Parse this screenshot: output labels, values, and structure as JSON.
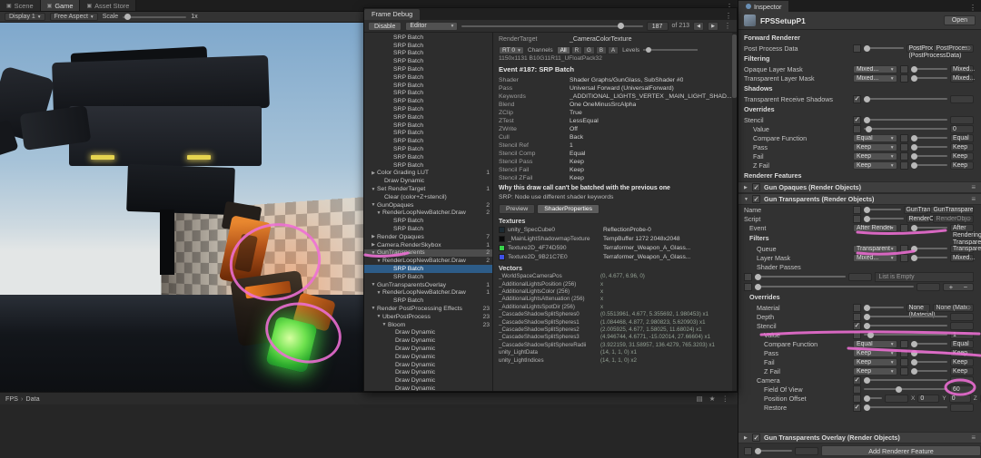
{
  "colors": {
    "annotation": "#ee6fd5",
    "selection": "#2d5c88",
    "glow_green": "#46e03c"
  },
  "icons": {
    "menu": "⋮",
    "star": "★",
    "grid": "▤",
    "prev": "◀",
    "next": "▶",
    "target": "⊙",
    "handle": "≡",
    "cube": "▣"
  },
  "scene_tabs": {
    "tabs": [
      {
        "label": "Scene"
      },
      {
        "label": "Game",
        "active": true
      },
      {
        "label": "Asset Store"
      }
    ]
  },
  "game_toolbar": {
    "display": "Display 1",
    "aspect": "Free Aspect",
    "scale_label": "Scale",
    "scale_value": "1x"
  },
  "project_bar": {
    "root": "FPS",
    "sep": "›",
    "folder": "Data"
  },
  "frame_debug": {
    "title": "Frame Debug",
    "toolbar": {
      "disable": "Disable",
      "target": "Editor",
      "current": "187",
      "total": "of 213"
    },
    "tree": [
      {
        "t": "SRP Batch",
        "pad": "24px"
      },
      {
        "t": "SRP Batch",
        "pad": "24px"
      },
      {
        "t": "SRP Batch",
        "pad": "24px"
      },
      {
        "t": "SRP Batch",
        "pad": "24px"
      },
      {
        "t": "SRP Batch",
        "pad": "24px"
      },
      {
        "t": "SRP Batch",
        "pad": "24px"
      },
      {
        "t": "SRP Batch",
        "pad": "24px"
      },
      {
        "t": "SRP Batch",
        "pad": "24px"
      },
      {
        "t": "SRP Batch",
        "pad": "24px"
      },
      {
        "t": "SRP Batch",
        "pad": "24px"
      },
      {
        "t": "SRP Batch",
        "pad": "24px"
      },
      {
        "t": "SRP Batch",
        "pad": "24px"
      },
      {
        "t": "SRP Batch",
        "pad": "24px"
      },
      {
        "t": "SRP Batch",
        "pad": "24px"
      },
      {
        "t": "SRP Batch",
        "pad": "24px"
      },
      {
        "t": "SRP Batch",
        "pad": "24px"
      },
      {
        "t": "SRP Batch",
        "pad": "24px"
      },
      {
        "t": "Color Grading LUT",
        "pad": "6px",
        "a": "▶",
        "n": "1"
      },
      {
        "t": "Draw Dynamic",
        "pad": "14px"
      },
      {
        "t": "Set RenderTarget",
        "pad": "6px",
        "a": "▼",
        "n": "1"
      },
      {
        "t": "Clear (color+Z+stencil)",
        "pad": "14px"
      },
      {
        "t": "GunOpaques",
        "pad": "6px",
        "a": "▼",
        "n": "2"
      },
      {
        "t": "RenderLoopNewBatcher.Draw",
        "pad": "12px",
        "a": "▼",
        "n": "2"
      },
      {
        "t": "SRP Batch",
        "pad": "24px"
      },
      {
        "t": "SRP Batch",
        "pad": "24px"
      },
      {
        "t": "Render Opaques",
        "pad": "6px",
        "a": "▶",
        "n": "7"
      },
      {
        "t": "Camera.RenderSkybox",
        "pad": "6px",
        "a": "▶",
        "n": "1"
      },
      {
        "t": "GunTransparents",
        "pad": "6px",
        "a": "▼",
        "n": "2",
        "hl": true
      },
      {
        "t": "RenderLoopNewBatcher.Draw",
        "pad": "12px",
        "a": "▼",
        "n": "2"
      },
      {
        "t": "SRP Batch",
        "pad": "24px",
        "sel": true
      },
      {
        "t": "SRP Batch",
        "pad": "24px"
      },
      {
        "t": "GunTransparentsOverlay",
        "pad": "6px",
        "a": "▼",
        "n": "1"
      },
      {
        "t": "RenderLoopNewBatcher.Draw",
        "pad": "12px",
        "a": "▼",
        "n": "1"
      },
      {
        "t": "SRP Batch",
        "pad": "24px"
      },
      {
        "t": "Render PostProcessing Effects",
        "pad": "6px",
        "a": "▼",
        "n": "23"
      },
      {
        "t": "UberPostProcess",
        "pad": "12px",
        "a": "▼",
        "n": "23"
      },
      {
        "t": "Bloom",
        "pad": "18px",
        "a": "▼",
        "n": "23"
      },
      {
        "t": "Draw Dynamic",
        "pad": "26px"
      },
      {
        "t": "Draw Dynamic",
        "pad": "26px"
      },
      {
        "t": "Draw Dynamic",
        "pad": "26px"
      },
      {
        "t": "Draw Dynamic",
        "pad": "26px"
      },
      {
        "t": "Draw Dynamic",
        "pad": "26px"
      },
      {
        "t": "Draw Dynamic",
        "pad": "26px"
      },
      {
        "t": "Draw Dynamic",
        "pad": "26px"
      },
      {
        "t": "Draw Dynamic",
        "pad": "26px"
      }
    ],
    "details": {
      "render_target_label": "RenderTarget",
      "render_target_value": "_CameraColorTexture",
      "rt_dropdown": "RT 0",
      "channels_label": "Channels",
      "channels": [
        {
          "label": "All",
          "active": true
        },
        {
          "label": "R"
        },
        {
          "label": "G"
        },
        {
          "label": "B"
        },
        {
          "label": "A"
        }
      ],
      "levels_label": "Levels",
      "size_info": "1150x1131  B10G11R11_UFloatPack32",
      "event_title": "Event #187: SRP Batch",
      "properties": [
        {
          "label": "Shader",
          "value": "Shader Graphs/GunGlass, SubShader #0"
        },
        {
          "label": "Pass",
          "value": "Universal Forward (UniversalForward)"
        },
        {
          "label": "Keywords",
          "value": "_ADDITIONAL_LIGHTS_VERTEX _MAIN_LIGHT_SHAD..."
        },
        {
          "label": "Blend",
          "value": "One OneMinusSrcAlpha"
        },
        {
          "label": "ZClip",
          "value": "True"
        },
        {
          "label": "ZTest",
          "value": "LessEqual"
        },
        {
          "label": "ZWrite",
          "value": "Off"
        },
        {
          "label": "Cull",
          "value": "Back"
        },
        {
          "label": "Stencil Ref",
          "value": "1"
        },
        {
          "label": "Stencil Comp",
          "value": "Equal"
        },
        {
          "label": "Stencil Pass",
          "value": "Keep"
        },
        {
          "label": "Stencil Fail",
          "value": "Keep"
        },
        {
          "label": "Stencil ZFail",
          "value": "Keep"
        }
      ],
      "batch_note_title": "Why this draw call can't be batched with the previous one",
      "batch_note_reason": "SRP: Node use different shader keywords",
      "tabs": [
        {
          "label": "Preview"
        },
        {
          "label": "ShaderProperties",
          "active": true
        }
      ],
      "textures_title": "Textures",
      "textures": [
        {
          "name": "unity_SpecCube0",
          "value": "ReflectionProbe-0",
          "swatch": "#1d2b33"
        },
        {
          "name": "_MainLightShadowmapTexture",
          "value": "TempBuffer 1272 2048x2048",
          "swatch": "#0a0a0a"
        },
        {
          "name": "Texture2D_4F74D590",
          "value": "Terraformer_Weapon_A_Glass...",
          "swatch": "#37d24a"
        },
        {
          "name": "Texture2D_9B21C7E0",
          "value": "Terraformer_Weapon_A_Glass...",
          "swatch": "#3f51e8"
        }
      ],
      "vectors_title": "Vectors",
      "vectors": [
        {
          "name": "_WorldSpaceCameraPos",
          "value": "(0, 4.677, 6.96, 0)"
        },
        {
          "name": "_AdditionalLightsPosition (256)",
          "value": "x"
        },
        {
          "name": "_AdditionalLightsColor (256)",
          "value": "x"
        },
        {
          "name": "_AdditionalLightsAttenuation (256)",
          "value": "x"
        },
        {
          "name": "_AdditionalLightsSpotDir (256)",
          "value": "x"
        },
        {
          "name": "_CascadeShadowSplitSpheres0",
          "value": "(0.5513961, 4.677, 5.355692, 1.980453)  x1"
        },
        {
          "name": "_CascadeShadowSplitSpheres1",
          "value": "(1.084468, 4.877, 2.980823, 5.620903)  x1"
        },
        {
          "name": "_CascadeShadowSplitSpheres2",
          "value": "(2.005925, 4.677, 1.58025, 11.68024)  x1"
        },
        {
          "name": "_CascadeShadowSplitSpheres3",
          "value": "(4.946744, 4.6771, -15.02014, 27.66604)  x1"
        },
        {
          "name": "_CascadeShadowSplitSphereRadii",
          "value": "(3.922159, 31.58957, 136.4279, 765.3203)  x1"
        },
        {
          "name": "unity_LightData",
          "value": "(14, 1, 1, 0)  x1"
        },
        {
          "name": "unity_LightIndices",
          "value": "(14, 1, 1, 0)  x2"
        }
      ]
    }
  },
  "inspector": {
    "tab": "Inspector",
    "title": "FPSSetupP1",
    "open_button": "Open",
    "axis": {
      "x": "X",
      "y": "Y",
      "z": "Z"
    },
    "rows": [
      {
        "type": "section",
        "label": "Forward Renderer"
      },
      {
        "type": "object",
        "label": "Post Process Data",
        "value": "PostProcessData (PostProcessData)"
      },
      {
        "type": "section",
        "label": "Filtering"
      },
      {
        "type": "dropdown",
        "label": "Opaque Layer Mask",
        "value": "Mixed..."
      },
      {
        "type": "dropdown",
        "label": "Transparent Layer Mask",
        "value": "Mixed..."
      },
      {
        "type": "section",
        "label": "Shadows"
      },
      {
        "type": "checkbox",
        "label": "Transparent Receive Shadows",
        "checked": true
      },
      {
        "type": "section",
        "label": "Overrides"
      },
      {
        "type": "checkbox",
        "label": "Stencil",
        "checked": true
      },
      {
        "type": "slider",
        "label": "Value",
        "value": "0",
        "pct": "2%",
        "ind": "10px"
      },
      {
        "type": "dropdown",
        "label": "Compare Function",
        "value": "Equal",
        "ind": "10px"
      },
      {
        "type": "dropdown",
        "label": "Pass",
        "value": "Keep",
        "ind": "10px"
      },
      {
        "type": "dropdown",
        "label": "Fail",
        "value": "Keep",
        "ind": "10px"
      },
      {
        "type": "dropdown",
        "label": "Z Fail",
        "value": "Keep",
        "ind": "10px"
      },
      {
        "type": "section",
        "label": "Renderer Features"
      },
      {
        "type": "feature",
        "label": "Gun Opaques (Render Objects)",
        "arrow": "▶",
        "checked": true
      },
      {
        "type": "feature",
        "label": "Gun Transparents (Render Objects)",
        "arrow": "▼",
        "checked": true
      },
      {
        "type": "text",
        "label": "Name",
        "value": "GunTransparents"
      },
      {
        "type": "object",
        "label": "Script",
        "value": "RenderObjects",
        "grayed": true
      },
      {
        "type": "dropdown",
        "label": "Event",
        "value": "After Rendering Transparents",
        "ind": "6px"
      },
      {
        "type": "subsection",
        "label": "Filters",
        "ind": "6px"
      },
      {
        "type": "dropdown",
        "label": "Queue",
        "value": "Transparent",
        "ind": "14px"
      },
      {
        "type": "dropdown",
        "label": "Layer Mask",
        "value": "Mixed...",
        "ind": "14px"
      },
      {
        "type": "label",
        "label": "Shader Passes",
        "ind": "14px"
      },
      {
        "type": "empty",
        "label": "List is Empty",
        "ind": "14px"
      },
      {
        "type": "plusminus",
        "plus": "+",
        "minus": "−"
      },
      {
        "type": "subsection",
        "label": "Overrides",
        "ind": "6px"
      },
      {
        "type": "object",
        "label": "Material",
        "value": "None (Material)",
        "ind": "14px"
      },
      {
        "type": "checkbox",
        "label": "Depth",
        "ind": "14px"
      },
      {
        "type": "checkbox",
        "label": "Stencil",
        "checked": true,
        "ind": "14px"
      },
      {
        "type": "slider",
        "label": "Value",
        "value": "1",
        "pct": "4%",
        "ind": "22px"
      },
      {
        "type": "dropdown",
        "label": "Compare Function",
        "value": "Equal",
        "ind": "22px"
      },
      {
        "type": "dropdown",
        "label": "Pass",
        "value": "Keep",
        "ind": "22px"
      },
      {
        "type": "dropdown",
        "label": "Fail",
        "value": "Keep",
        "ind": "22px"
      },
      {
        "type": "dropdown",
        "label": "Z Fail",
        "value": "Keep",
        "ind": "22px"
      },
      {
        "type": "checkbox",
        "label": "Camera",
        "checked": true,
        "ind": "14px"
      },
      {
        "type": "slider",
        "label": "Field Of View",
        "value": "60",
        "pct": "38%",
        "ind": "22px"
      },
      {
        "type": "vec3",
        "label": "Position Offset",
        "vx": "0",
        "vy": "0",
        "vz": "0",
        "ind": "22px"
      },
      {
        "type": "checkbox",
        "label": "Restore",
        "checked": true,
        "ind": "22px"
      },
      {
        "type": "spacer"
      },
      {
        "type": "feature",
        "label": "Gun Transparents Overlay (Render Objects)",
        "arrow": "▶",
        "checked": true
      },
      {
        "type": "buttonrow",
        "label": "Add Renderer Feature"
      }
    ]
  }
}
